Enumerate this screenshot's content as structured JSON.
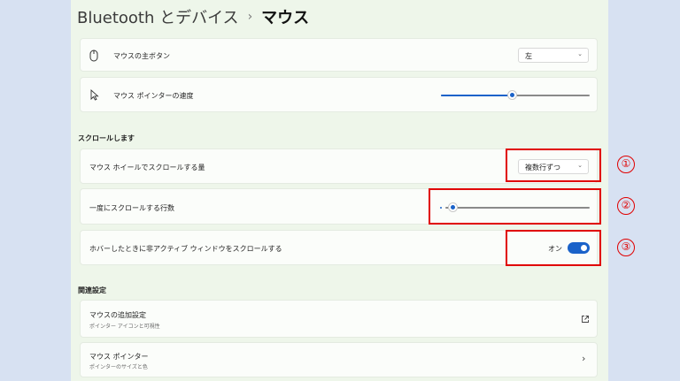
{
  "breadcrumb": {
    "parent": "Bluetooth とデバイス",
    "separator": "›",
    "current": "マウス"
  },
  "settings": {
    "primary_button": {
      "label": "マウスの主ボタン",
      "value": "左"
    },
    "pointer_speed": {
      "label": "マウス ポインターの速度",
      "level": 0.48
    }
  },
  "scroll_section": {
    "heading": "スクロールします",
    "wheel_scroll": {
      "label": "マウス ホイールでスクロールする量",
      "value": "複数行ずつ"
    },
    "lines_at_once": {
      "label": "一度にスクロールする行数",
      "level": 0.05
    },
    "inactive_scroll": {
      "label": "ホバーしたときに非アクティブ ウィンドウをスクロールする",
      "state": "オン"
    }
  },
  "annotations": [
    "①",
    "②",
    "③"
  ],
  "related_section": {
    "heading": "関連設定",
    "additional": {
      "title": "マウスの追加設定",
      "subtitle": "ポインター アイコンと可視性"
    },
    "pointer": {
      "title": "マウス ポインター",
      "subtitle": "ポインターのサイズと色"
    }
  },
  "colors": {
    "accent": "#1a62c9",
    "annotation": "#e00000",
    "panel": "#eef6ea",
    "backdrop": "#d7e1f2"
  }
}
